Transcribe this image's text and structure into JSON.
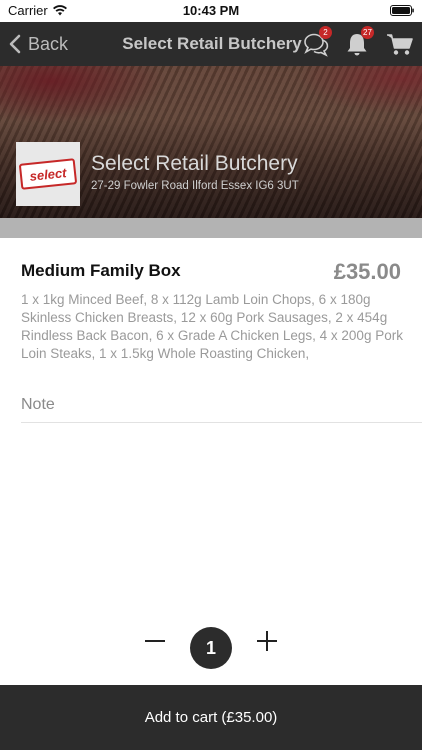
{
  "status_bar": {
    "carrier": "Carrier",
    "time": "10:43 PM"
  },
  "nav": {
    "back_label": "Back",
    "title": "Select Retail Butchery",
    "chat_badge": "2",
    "notification_badge": "27",
    "icons": [
      "chevron-left-icon",
      "chat-icon",
      "bell-icon",
      "cart-icon"
    ]
  },
  "shop": {
    "logo_text": "select",
    "name": "Select Retail Butchery",
    "address": "27-29 Fowler Road Ilford Essex IG6 3UT"
  },
  "product": {
    "name": "Medium Family Box",
    "price": "£35.00",
    "description": "1 x 1kg Minced Beef, 8 x 112g Lamb Loin Chops, 6 x 180g Skinless Chicken Breasts, 12 x 60g Pork Sausages, 2 x 454g Rindless Back Bacon, 6 x Grade A Chicken Legs, 4 x 200g Pork Loin Steaks, 1 x 1.5kg Whole Roasting Chicken,"
  },
  "note": {
    "placeholder": "Note",
    "value": ""
  },
  "quantity": {
    "value": "1"
  },
  "cart_button": {
    "label": "Add to cart (£35.00)"
  },
  "colors": {
    "nav_bg": "#2c2c2c",
    "badge": "#c62828",
    "price": "#8a8a8a",
    "description": "#9a9a9a"
  }
}
